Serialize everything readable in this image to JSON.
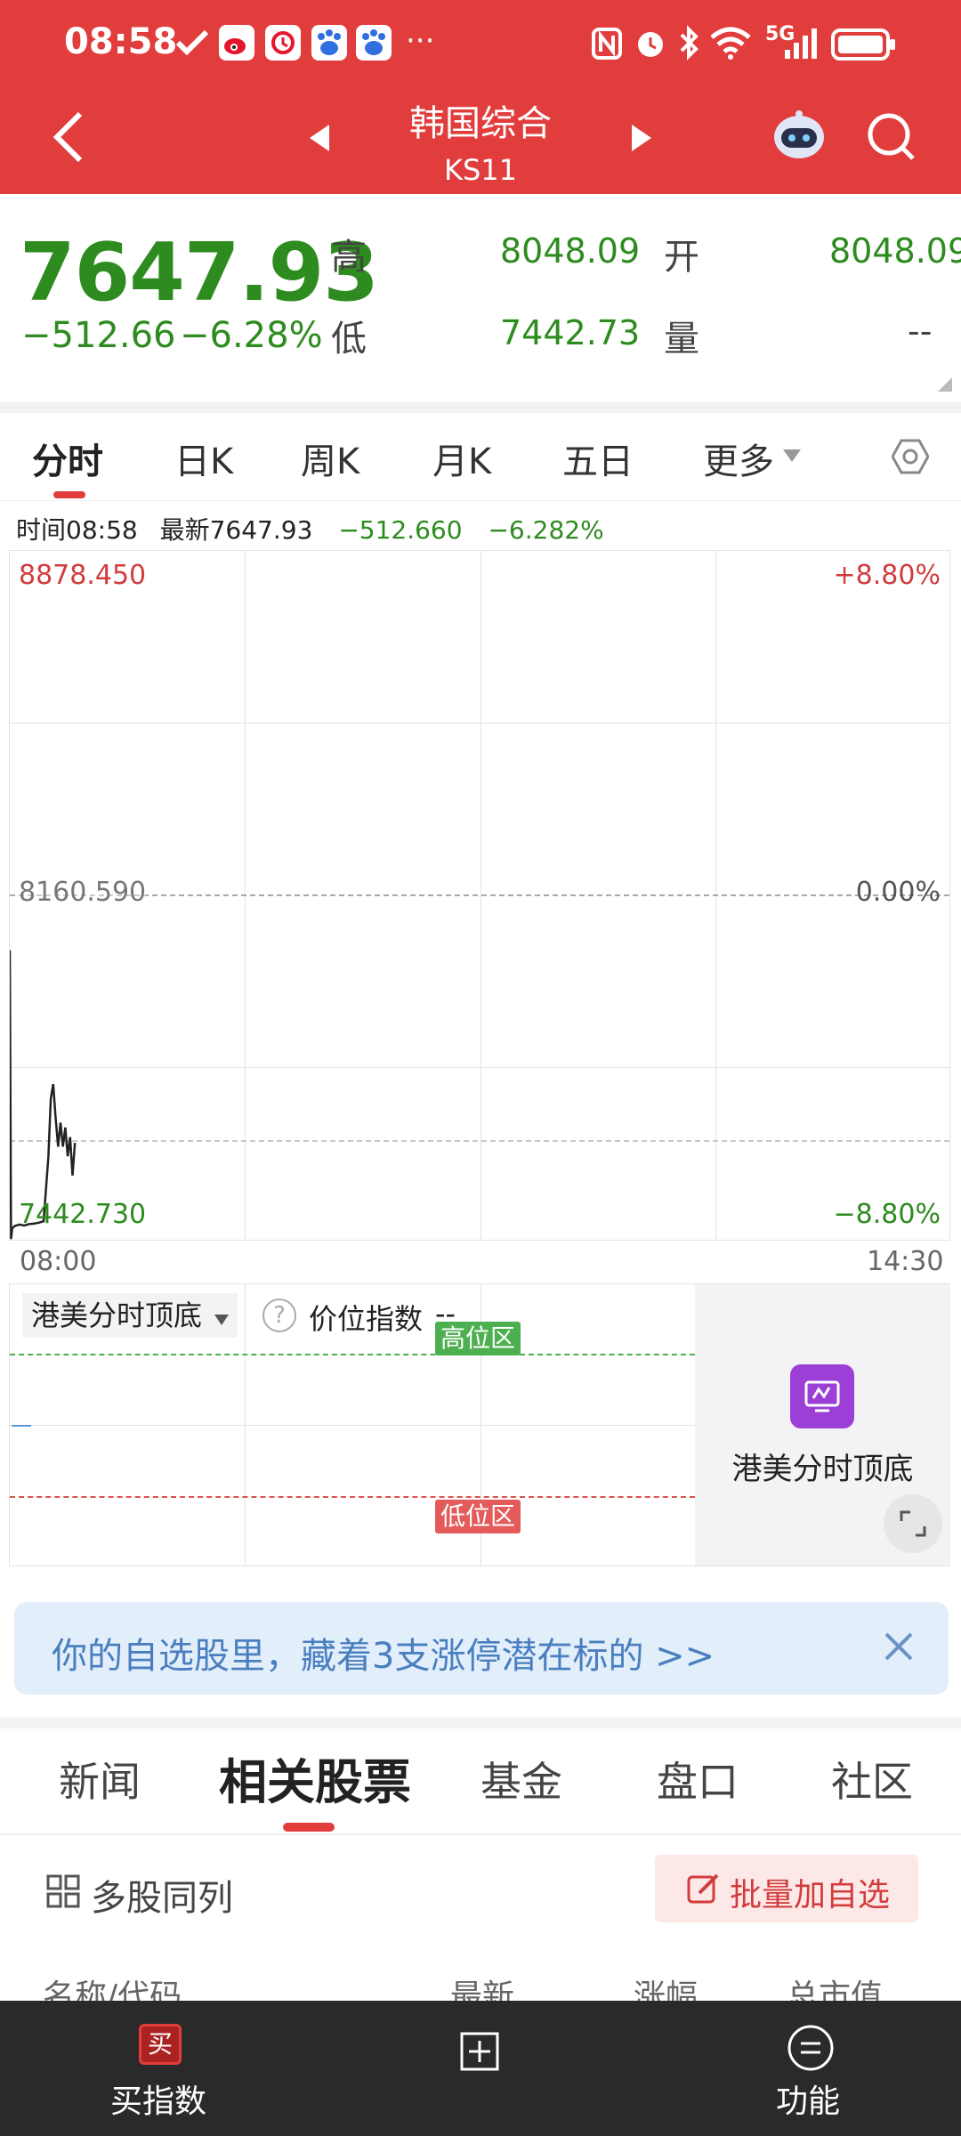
{
  "status_bar": {
    "time": "08:58",
    "more": "···",
    "network": "5G"
  },
  "nav": {
    "title": "韩国综合",
    "code": "KS11"
  },
  "quote": {
    "price": "7647.93",
    "change": "−512.66",
    "change_pct": "−6.28%",
    "high_label": "高",
    "high": "8048.09",
    "open_label": "开",
    "open": "8048.09",
    "low_label": "低",
    "low": "7442.73",
    "volume_label": "量",
    "volume": "-- "
  },
  "tabs": [
    "分时",
    "日K",
    "周K",
    "月K",
    "五日",
    "更多"
  ],
  "info_bar": {
    "time": "时间08:58",
    "latest": "最新7647.93",
    "change": "−512.660",
    "change_pct": "−6.282%"
  },
  "chart_data": {
    "type": "line",
    "y_max_label": "8878.450",
    "y_mid_label": "8160.590",
    "y_min_label": "7442.730",
    "pct_max_label": "+8.80%",
    "pct_mid_label": "0.00%",
    "pct_min_label": "−8.80%",
    "x_start": "08:00",
    "x_end": "14:30",
    "ylim": [
      7442.73,
      8878.45
    ],
    "prev_close": 8160.59,
    "series": [
      {
        "x": [
          0,
          0.5,
          1,
          2,
          4,
          6,
          8,
          10,
          12,
          14,
          16,
          17,
          18,
          19,
          20,
          21,
          22,
          23,
          24,
          25,
          26,
          27
        ],
        "values": [
          8048.09,
          7448,
          7470,
          7475,
          7478,
          7476,
          7479,
          7480,
          7482,
          7485,
          7620,
          7740,
          7770,
          7700,
          7640,
          7690,
          7640,
          7680,
          7620,
          7660,
          7580,
          7647.93
        ]
      }
    ]
  },
  "indicator": {
    "name": "港美分时顶底",
    "help": "?",
    "value_label": "价位指数",
    "value": "--",
    "high_zone": "高位区",
    "low_zone": "低位区",
    "card_label": "港美分时顶底"
  },
  "banner": {
    "text": "你的自选股里，藏着3支涨停潜在标的 >>"
  },
  "section_tabs": [
    "新闻",
    "相关股票",
    "基金",
    "盘口",
    "社区"
  ],
  "list": {
    "multi_label": "多股同列",
    "batch_add": "批量加自选",
    "headers": [
      "名称/代码",
      "最新",
      "涨幅",
      "总市值"
    ]
  },
  "bottom_nav": {
    "buy_icon_char": "买",
    "buy_label": "买指数",
    "func_label": "功能"
  },
  "colors": {
    "header": "#e23d3d",
    "up": "#d23c3c",
    "down": "#2e8b1f",
    "banner_bg": "#e3eefb",
    "banner_text": "#4a7fbf"
  }
}
